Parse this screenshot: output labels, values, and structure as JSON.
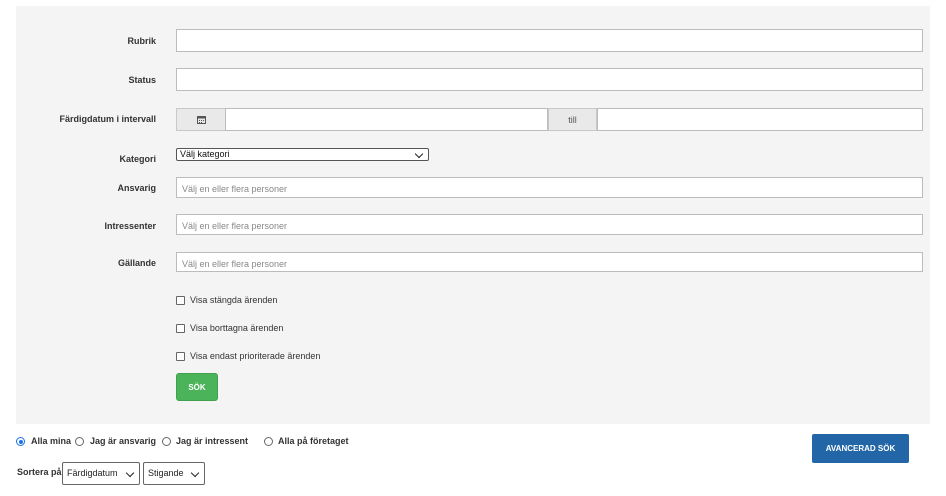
{
  "form": {
    "rubrik_label": "Rubrik",
    "rubrik_value": "",
    "status_label": "Status",
    "status_value": "",
    "fardigdatum_label": "Färdigdatum i intervall",
    "fardigdatum_from_value": "",
    "fardigdatum_till": "till",
    "fardigdatum_to_value": "",
    "kategori_label": "Kategori",
    "kategori_selected": "Välj kategori",
    "ansvarig_label": "Ansvarig",
    "ansvarig_placeholder": "Välj en eller flera personer",
    "intressenter_label": "Intressenter",
    "intressenter_placeholder": "Välj en eller flera personer",
    "gallande_label": "Gällande",
    "gallande_placeholder": "Välj en eller flera personer",
    "checkboxes": [
      {
        "label": "Visa stängda ärenden",
        "checked": false
      },
      {
        "label": "Visa borttagna ärenden",
        "checked": false
      },
      {
        "label": "Visa endast prioriterade ärenden",
        "checked": false
      }
    ],
    "search_button": "SÖK"
  },
  "filters": {
    "radios": [
      {
        "label": "Alla mina",
        "checked": true
      },
      {
        "label": "Jag är ansvarig",
        "checked": false
      },
      {
        "label": "Jag är intressent",
        "checked": false
      },
      {
        "label": "Alla på företaget",
        "checked": false
      }
    ],
    "advanced_button": "AVANCERAD SÖK",
    "sort_label": "Sortera på",
    "sort_field": "Färdigdatum",
    "sort_order": "Stigande"
  },
  "icons": {
    "calendar": "calendar-icon",
    "dropdown": "chevron-down-icon"
  },
  "colors": {
    "panel_bg": "#f4f4f4",
    "search_button": "#4bb35a",
    "advanced_button": "#2366a8",
    "radio_active": "#1a73e8"
  }
}
